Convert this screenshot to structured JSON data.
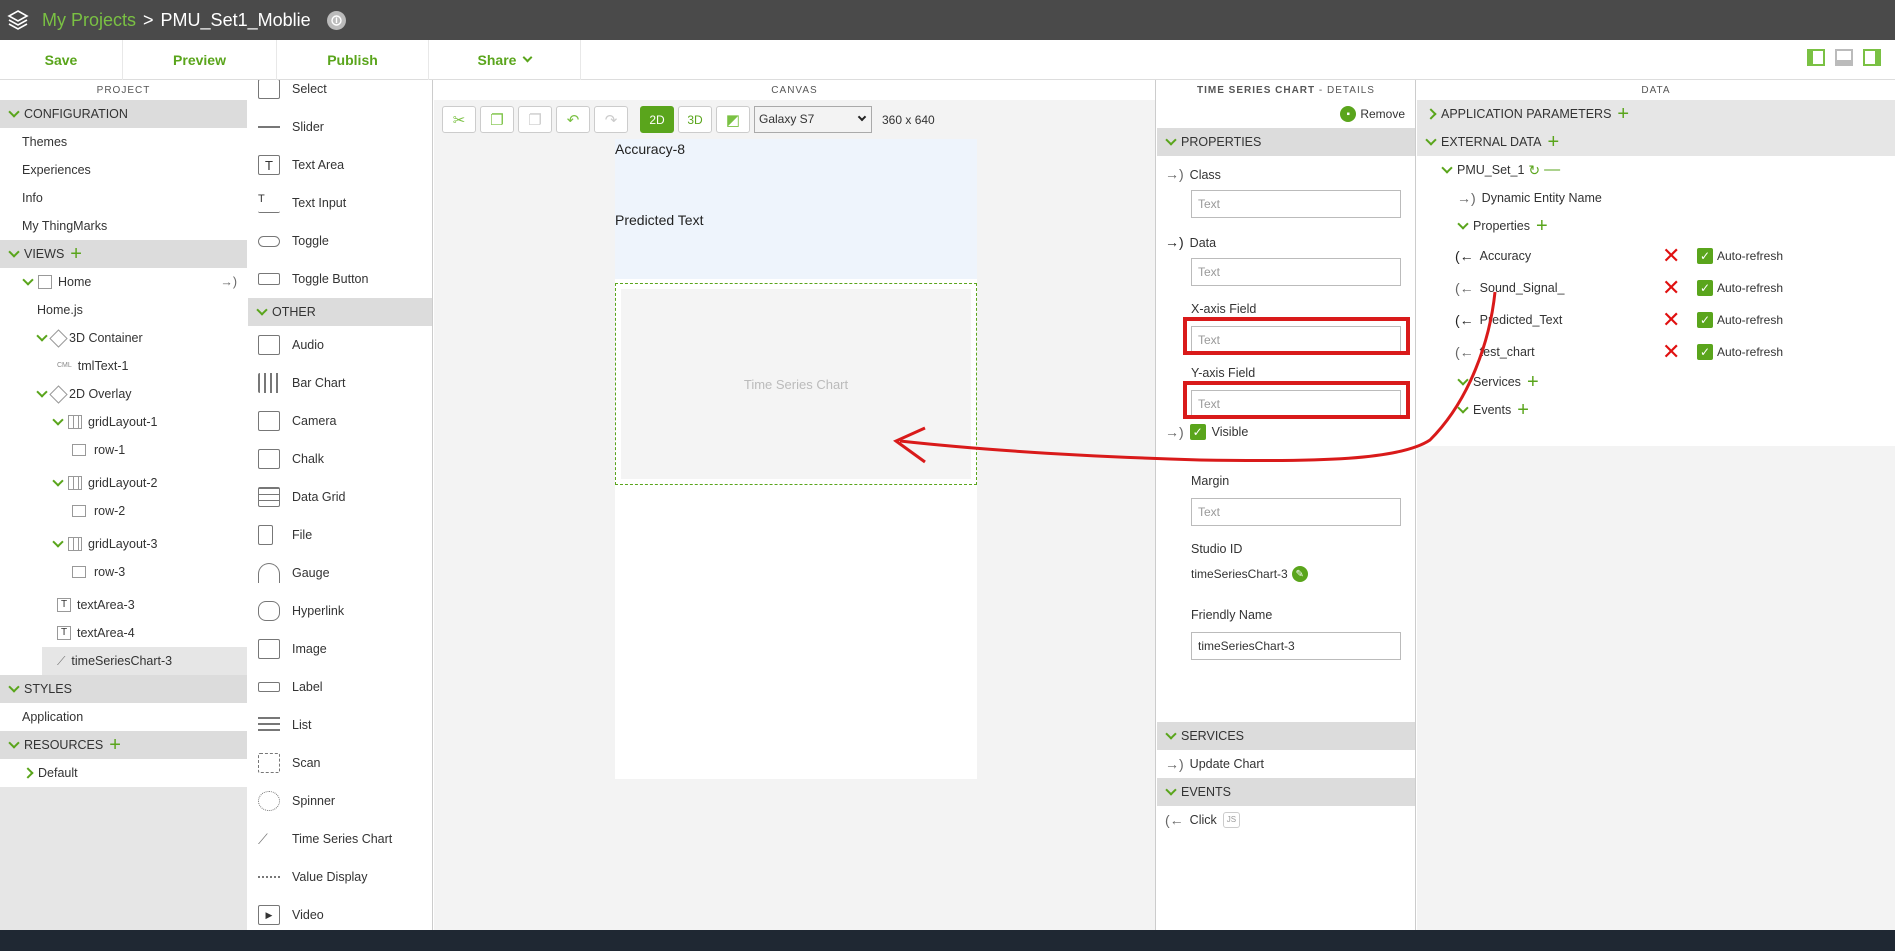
{
  "header": {
    "crumb": "My Projects",
    "separator": ">",
    "project": "PMU_Set1_Moblie"
  },
  "toolbar": {
    "save": "Save",
    "preview": "Preview",
    "publish": "Publish",
    "share": "Share"
  },
  "project_panel": {
    "title": "PROJECT",
    "configuration": "CONFIGURATION",
    "config_items": [
      "Themes",
      "Experiences",
      "Info",
      "My ThingMarks"
    ],
    "views": "VIEWS",
    "home": "Home",
    "home_js": "Home.js",
    "container_3d": "3D Container",
    "tml_text": "tmlText-1",
    "overlay_2d": "2D Overlay",
    "grid1": "gridLayout-1",
    "row1": "row-1",
    "grid2": "gridLayout-2",
    "row2": "row-2",
    "grid3": "gridLayout-3",
    "row3": "row-3",
    "textarea3": "textArea-3",
    "textarea4": "textArea-4",
    "tsc": "timeSeriesChart-3",
    "styles": "STYLES",
    "application": "Application",
    "resources": "RESOURCES",
    "default": "Default"
  },
  "palette": {
    "top_items": [
      "Select",
      "Slider",
      "Text Area",
      "Text Input",
      "Toggle",
      "Toggle Button"
    ],
    "other": "OTHER",
    "other_items": [
      "Audio",
      "Bar Chart",
      "Camera",
      "Chalk",
      "Data Grid",
      "File",
      "Gauge",
      "Hyperlink",
      "Image",
      "Label",
      "List",
      "Scan",
      "Spinner",
      "Time Series Chart",
      "Value Display",
      "Video"
    ]
  },
  "canvas": {
    "title": "CANVAS",
    "btn_2d": "2D",
    "btn_3d": "3D",
    "device": "Galaxy S7",
    "resolution": "360 x 640",
    "accuracy": "Accuracy-8",
    "predicted": "Predicted Text",
    "chart_placeholder": "Time Series Chart"
  },
  "details": {
    "title_strong": "TIME SERIES CHART",
    "title_rest": " - DETAILS",
    "remove": "Remove",
    "properties": "PROPERTIES",
    "class_label": "Class",
    "data_label": "Data",
    "xaxis_label": "X-axis Field",
    "yaxis_label": "Y-axis Field",
    "visible_label": "Visible",
    "margin_label": "Margin",
    "studio_id_label": "Studio ID",
    "studio_id_value": "timeSeriesChart-3",
    "friendly_label": "Friendly Name",
    "friendly_value": "timeSeriesChart-3",
    "placeholder": "Text",
    "services": "SERVICES",
    "update_chart": "Update Chart",
    "events": "EVENTS",
    "click": "Click",
    "js_badge": "JS"
  },
  "data_panel": {
    "title": "DATA",
    "app_params": "APPLICATION PARAMETERS",
    "external": "EXTERNAL DATA",
    "entity": "PMU_Set_1",
    "dynamic": "Dynamic Entity Name",
    "properties": "Properties",
    "props": [
      {
        "name": "Accuracy",
        "refresh": "Auto-refresh"
      },
      {
        "name": "Sound_Signal_",
        "refresh": "Auto-refresh"
      },
      {
        "name": "Predicted_Text",
        "refresh": "Auto-refresh"
      },
      {
        "name": "test_chart",
        "refresh": "Auto-refresh"
      }
    ],
    "services": "Services",
    "events": "Events"
  },
  "colors": {
    "accent": "#5aa51c",
    "highlight": "#d91a1a"
  }
}
